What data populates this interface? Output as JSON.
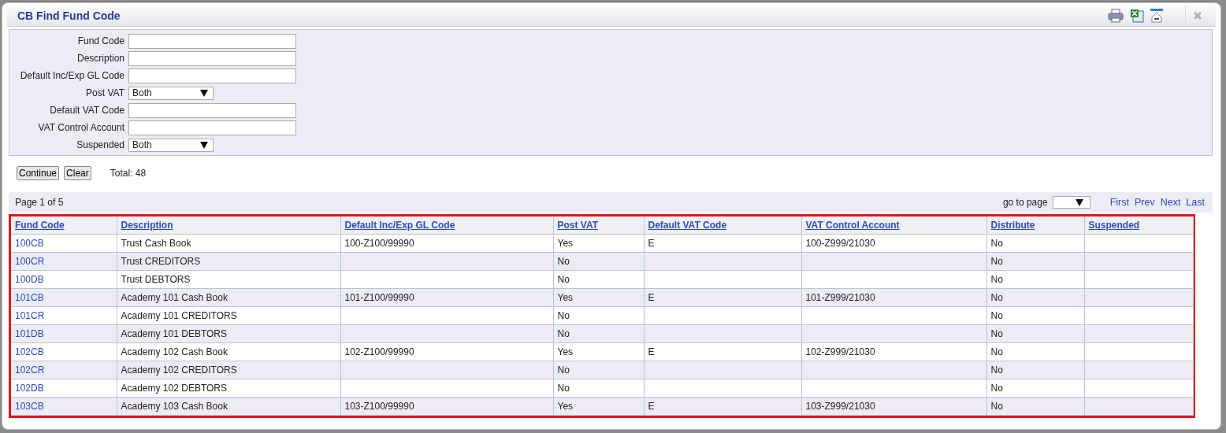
{
  "window": {
    "title": "CB Find Fund Code"
  },
  "filters": [
    {
      "label": "Fund Code",
      "kind": "text"
    },
    {
      "label": "Description",
      "kind": "text"
    },
    {
      "label": "Default Inc/Exp GL Code",
      "kind": "text"
    },
    {
      "label": "Post VAT",
      "kind": "select",
      "value": "Both"
    },
    {
      "label": "Default VAT Code",
      "kind": "text"
    },
    {
      "label": "VAT Control Account",
      "kind": "text"
    },
    {
      "label": "Suspended",
      "kind": "select",
      "value": "Both"
    }
  ],
  "buttons": [
    "Continue",
    "Clear"
  ],
  "total": "Total: 48",
  "pager": {
    "page_info": "Page 1 of 5",
    "goto_label": "go to page",
    "links": [
      "First",
      "Prev",
      "Next",
      "Last"
    ]
  },
  "table": {
    "columns": [
      "Fund Code",
      "Description",
      "Default Inc/Exp GL Code",
      "Post VAT",
      "Default VAT Code",
      "VAT Control Account",
      "Distribute",
      "Suspended"
    ],
    "rows": [
      [
        "100CB",
        "Trust Cash Book",
        "100-Z100/99990",
        "Yes",
        "E",
        "100-Z999/21030",
        "No",
        ""
      ],
      [
        "100CR",
        "Trust CREDITORS",
        "",
        "No",
        "",
        "",
        "No",
        ""
      ],
      [
        "100DB",
        "Trust DEBTORS",
        "",
        "No",
        "",
        "",
        "No",
        ""
      ],
      [
        "101CB",
        "Academy 101 Cash Book",
        "101-Z100/99990",
        "Yes",
        "E",
        "101-Z999/21030",
        "No",
        ""
      ],
      [
        "101CR",
        "Academy 101 CREDITORS",
        "",
        "No",
        "",
        "",
        "No",
        ""
      ],
      [
        "101DB",
        "Academy 101 DEBTORS",
        "",
        "No",
        "",
        "",
        "No",
        ""
      ],
      [
        "102CB",
        "Academy 102 Cash Book",
        "102-Z100/99990",
        "Yes",
        "E",
        "102-Z999/21030",
        "No",
        ""
      ],
      [
        "102CR",
        "Academy 102 CREDITORS",
        "",
        "No",
        "",
        "",
        "No",
        ""
      ],
      [
        "102DB",
        "Academy 102 DEBTORS",
        "",
        "No",
        "",
        "",
        "No",
        ""
      ],
      [
        "103CB",
        "Academy 103 Cash Book",
        "103-Z100/99990",
        "Yes",
        "E",
        "103-Z999/21030",
        "No",
        ""
      ]
    ]
  }
}
